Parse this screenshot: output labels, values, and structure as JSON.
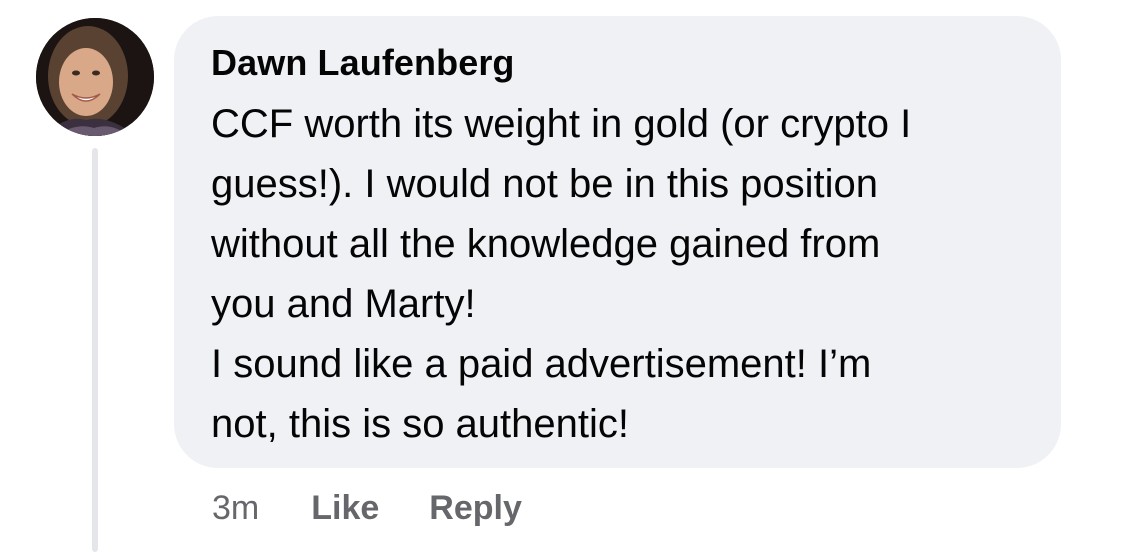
{
  "comment": {
    "author": "Dawn Laufenberg",
    "lines": [
      "CCF worth its weight in gold (or crypto I",
      "guess!). I would not be in this position",
      "without all the knowledge gained from",
      "you and Marty!",
      "I sound like a paid advertisement! I’m",
      "not, this is so authentic!"
    ],
    "timestamp": "3m",
    "like_label": "Like",
    "reply_label": "Reply"
  },
  "colors": {
    "bubble_bg": "#eff1f5",
    "text": "#050505",
    "secondary_text": "#65676b",
    "thread_line": "#e4e6ea"
  }
}
